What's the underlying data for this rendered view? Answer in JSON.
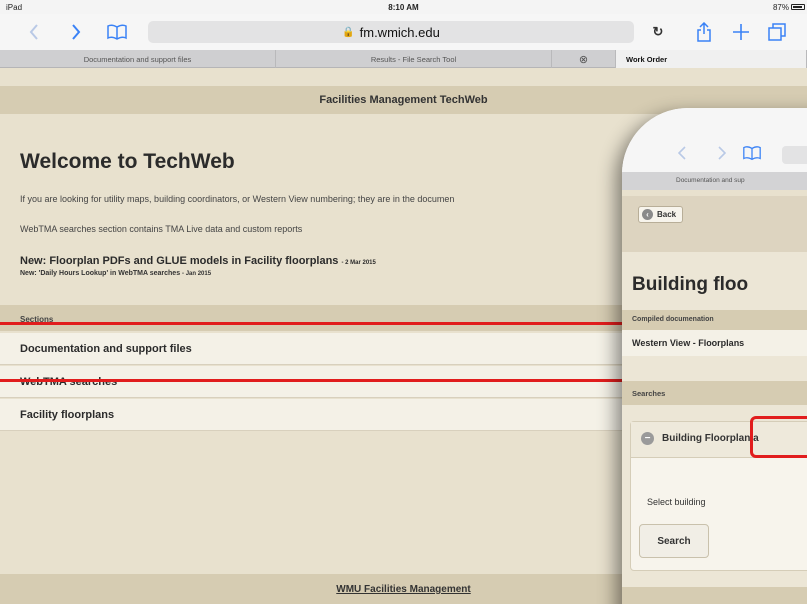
{
  "status_bar": {
    "device": "iPad",
    "time": "8:10 AM",
    "battery": "87%"
  },
  "browser": {
    "url": "fm.wmich.edu",
    "tabs": [
      {
        "label": "Documentation and support files"
      },
      {
        "label": "Results - File Search Tool"
      },
      {
        "label": "Work Order"
      }
    ]
  },
  "page": {
    "header": "Facilities Management TechWeb",
    "title": "Welcome to TechWeb",
    "intro": "If you are looking for utility maps, building coordinators, or Western View numbering; they are in the documen",
    "webtma_note": "WebTMA searches section contains TMA Live data and custom reports",
    "news": [
      {
        "text": "New: Floorplan PDFs and GLUE models in Facility floorplans",
        "date": "- 2 Mar 2015"
      },
      {
        "text": "New: 'Daily Hours Lookup' in WebTMA searches",
        "date": "- Jan 2015"
      }
    ],
    "sections_label": "Sections",
    "sections": [
      {
        "label": "Documentation and support files"
      },
      {
        "label": "WebTMA searches"
      },
      {
        "label": "Facility floorplans"
      }
    ],
    "footer": "WMU Facilities Management"
  },
  "phone": {
    "tab_label": "Documentation and sup",
    "back_label": "Back",
    "title": "Building floo",
    "compiled_label": "Compiled documenation",
    "row_label": "Western View - Floorplans",
    "searches_label": "Searches",
    "card_title": "Building Floorplan a",
    "select_label": "Select building",
    "search_button": "Search"
  },
  "colors": {
    "accent": "#3a82f6",
    "annotation_red": "#e11d1d",
    "band": "#d6ccb2"
  }
}
